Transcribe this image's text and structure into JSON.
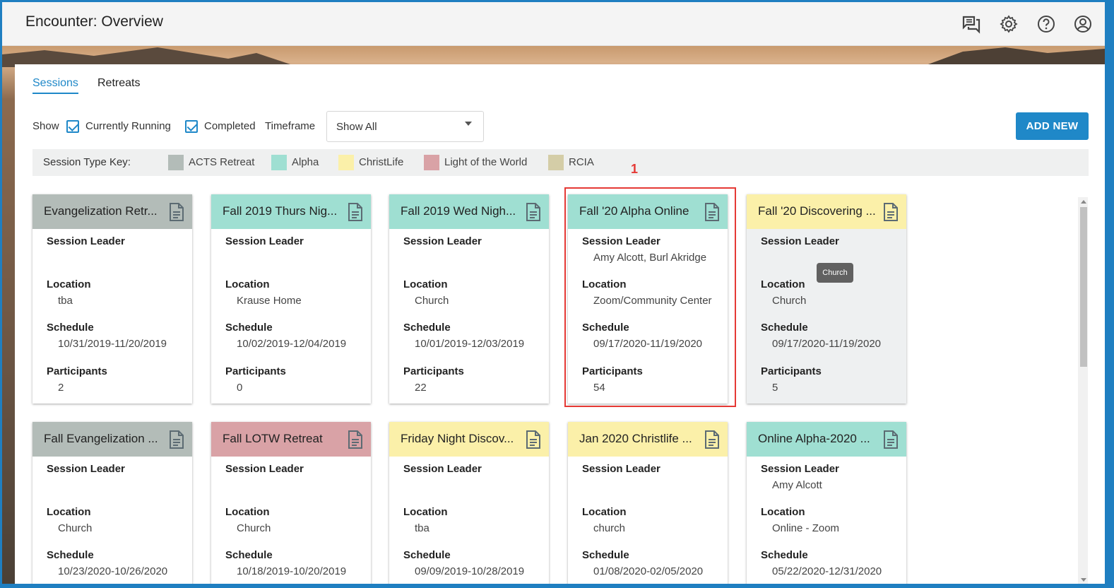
{
  "header": {
    "title": "Encounter: Overview",
    "icons": [
      "chat-icon",
      "gear-icon",
      "help-icon",
      "account-icon"
    ]
  },
  "tabs": [
    {
      "label": "Sessions",
      "active": true
    },
    {
      "label": "Retreats",
      "active": false
    }
  ],
  "filters": {
    "show_label": "Show",
    "currently_running_label": "Currently Running",
    "currently_running_checked": true,
    "completed_label": "Completed",
    "completed_checked": true,
    "timeframe_label": "Timeframe",
    "timeframe_value": "Show All"
  },
  "add_new_label": "ADD NEW",
  "key": {
    "title": "Session Type Key:",
    "items": [
      {
        "label": "ACTS Retreat",
        "color": "#b3bcb8"
      },
      {
        "label": "Alpha",
        "color": "#9fdfd2"
      },
      {
        "label": "ChristLife",
        "color": "#fbf0a9"
      },
      {
        "label": "Light of the World",
        "color": "#d9a2a6"
      },
      {
        "label": "RCIA",
        "color": "#d4cda7"
      }
    ]
  },
  "annotation": "1",
  "tooltip": "Church",
  "labels": {
    "leader": "Session Leader",
    "location": "Location",
    "schedule": "Schedule",
    "participants": "Participants"
  },
  "cards": [
    {
      "title": "Evangelization Retr...",
      "color": "#b3bcb8",
      "leader": "",
      "location": "tba",
      "schedule": "10/31/2019-11/20/2019",
      "participants": "2"
    },
    {
      "title": "Fall 2019 Thurs Nig...",
      "color": "#9fdfd2",
      "leader": "",
      "location": "Krause Home",
      "schedule": "10/02/2019-12/04/2019",
      "participants": "0"
    },
    {
      "title": "Fall 2019 Wed Nigh...",
      "color": "#9fdfd2",
      "leader": "",
      "location": "Church",
      "schedule": "10/01/2019-12/03/2019",
      "participants": "22"
    },
    {
      "title": "Fall '20 Alpha Online",
      "color": "#9fdfd2",
      "leader": "Amy Alcott, Burl Akridge",
      "location": "Zoom/Community Center",
      "schedule": "09/17/2020-11/19/2020",
      "participants": "54"
    },
    {
      "title": "Fall '20 Discovering ...",
      "color": "#fbf0a9",
      "leader": "",
      "location": "Church",
      "schedule": "09/17/2020-11/19/2020",
      "participants": "5"
    },
    {
      "title": "Fall Evangelization ...",
      "color": "#b3bcb8",
      "leader": "",
      "location": "Church",
      "schedule": "10/23/2020-10/26/2020",
      "participants": ""
    },
    {
      "title": "Fall LOTW Retreat",
      "color": "#d9a2a6",
      "leader": "",
      "location": "Church",
      "schedule": "10/18/2019-10/20/2019",
      "participants": ""
    },
    {
      "title": "Friday Night Discov...",
      "color": "#fbf0a9",
      "leader": "",
      "location": "tba",
      "schedule": "09/09/2019-10/28/2019",
      "participants": ""
    },
    {
      "title": "Jan 2020 Christlife ...",
      "color": "#fbf0a9",
      "leader": "",
      "location": "church",
      "schedule": "01/08/2020-02/05/2020",
      "participants": ""
    },
    {
      "title": "Online Alpha-2020 ...",
      "color": "#9fdfd2",
      "leader": "Amy Alcott",
      "location": "Online - Zoom",
      "schedule": "05/22/2020-12/31/2020",
      "participants": ""
    }
  ]
}
